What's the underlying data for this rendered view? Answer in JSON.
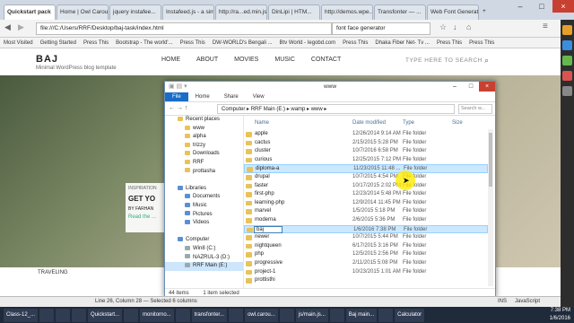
{
  "browser": {
    "tabs": [
      "Quickstart pack",
      "Home | Owl Carou...",
      "jquery instafee...",
      "Instafeed.js - a sim...",
      "http://ra...ed.min.js",
      "DinLipi | HTM...",
      "http://demos.wpe...",
      "Transfonter — ...",
      "Web Font Generator"
    ],
    "url": "file:///C:/Users/RRF/Desktop/baj-task/index.html",
    "search": "font face generator",
    "bookmarks": [
      "Most Visited",
      "Getting Started",
      "Press This",
      "Bootstrap - The world'...",
      "Press This",
      "DW-WORLD's Bengali ...",
      "Btv World - Iegobd.com",
      "Press This",
      "Dhaka Fiber Net- Tv ...",
      "Press This",
      "Press This"
    ]
  },
  "site": {
    "logo": "BAJ",
    "tagline": "Minimal WordPress blog template",
    "nav": [
      "HOME",
      "ABOUT",
      "MOVIES",
      "MUSIC",
      "CONTACT"
    ],
    "search_placeholder": "TYPE HERE TO SEARCH",
    "card_kicker": "INSPIRATION",
    "card_title": "GET YO",
    "card_byline": "BY FARHAN",
    "card_link": "Read the ...",
    "section_label": "TRAVELING"
  },
  "explorer": {
    "title": "www",
    "ribbon": [
      "File",
      "Home",
      "Share",
      "View"
    ],
    "breadcrumb": "Computer  ▸  RRF Main (E:)  ▸  wamp  ▸  www  ▸",
    "search_placeholder": "Search w...",
    "columns": {
      "name": "Name",
      "date": "Date modified",
      "type": "Type",
      "size": "Size"
    },
    "nav_items": [
      "Recent places",
      "www",
      "alpha",
      "trizzy",
      "Downloads",
      "RRF",
      "prottasha",
      "",
      "Libraries",
      "Documents",
      "Music",
      "Pictures",
      "Videos",
      "",
      "Computer",
      "Win8 (C:)",
      "NAZRUL-3 (D:)",
      "RRF Main (E:)"
    ],
    "files": [
      {
        "name": "apple",
        "date": "12/26/2014 9:14 AM",
        "type": "File folder"
      },
      {
        "name": "cactus",
        "date": "2/15/2015 5:28 PM",
        "type": "File folder"
      },
      {
        "name": "cluster",
        "date": "10/7/2016 6:58 PM",
        "type": "File folder"
      },
      {
        "name": "curious",
        "date": "12/25/2015 7:12 PM",
        "type": "File folder"
      },
      {
        "name": "diploma-a",
        "date": "11/23/2015 11:48 ...",
        "type": "File folder"
      },
      {
        "name": "drupal",
        "date": "10/7/2015 4:54 PM",
        "type": "File folder"
      },
      {
        "name": "faster",
        "date": "10/17/2015 2:02 PM",
        "type": "File folder"
      },
      {
        "name": "first-php",
        "date": "12/23/2014 5:48 PM",
        "type": "File folder"
      },
      {
        "name": "learning-php",
        "date": "12/9/2014 11:45 PM",
        "type": "File folder"
      },
      {
        "name": "marvel",
        "date": "1/5/2015 5:18 PM",
        "type": "File folder"
      },
      {
        "name": "moderna",
        "date": "2/6/2015 5:36 PM",
        "type": "File folder"
      },
      {
        "name": "baj",
        "date": "1/6/2016 7:38 PM",
        "type": "File folder"
      },
      {
        "name": "newer",
        "date": "10/7/2015 5:44 PM",
        "type": "File folder"
      },
      {
        "name": "nightqueen",
        "date": "6/17/2015 3:16 PM",
        "type": "File folder"
      },
      {
        "name": "php",
        "date": "12/5/2015 2:56 PM",
        "type": "File folder"
      },
      {
        "name": "progressive",
        "date": "2/11/2015 5:08 PM",
        "type": "File folder"
      },
      {
        "name": "project-1",
        "date": "10/23/2015 1:01 AM",
        "type": "File folder"
      },
      {
        "name": "prottisthi",
        "date": "",
        "type": ""
      }
    ],
    "status": [
      "44 items",
      "1 item selected"
    ]
  },
  "editor_status": "Line 26, Column 28 — Selected 6 columns",
  "taskbar": [
    "Class-12_...",
    "",
    "",
    "",
    "Quickstart...",
    "",
    "monitorno...",
    "",
    "transfonter...",
    "",
    "owl.carou...",
    "",
    "js/main.js...",
    "",
    "Baj main...",
    "",
    "Calculator"
  ],
  "tray": {
    "time": "7:38 PM",
    "date": "1/6/2016",
    "lang": "INS",
    "mode": "JavaScript"
  },
  "colors": {
    "accent": "#1a6dc7",
    "selection": "#cce8ff",
    "folder": "#e8c35a",
    "taskbar": "#1f2a3a"
  }
}
